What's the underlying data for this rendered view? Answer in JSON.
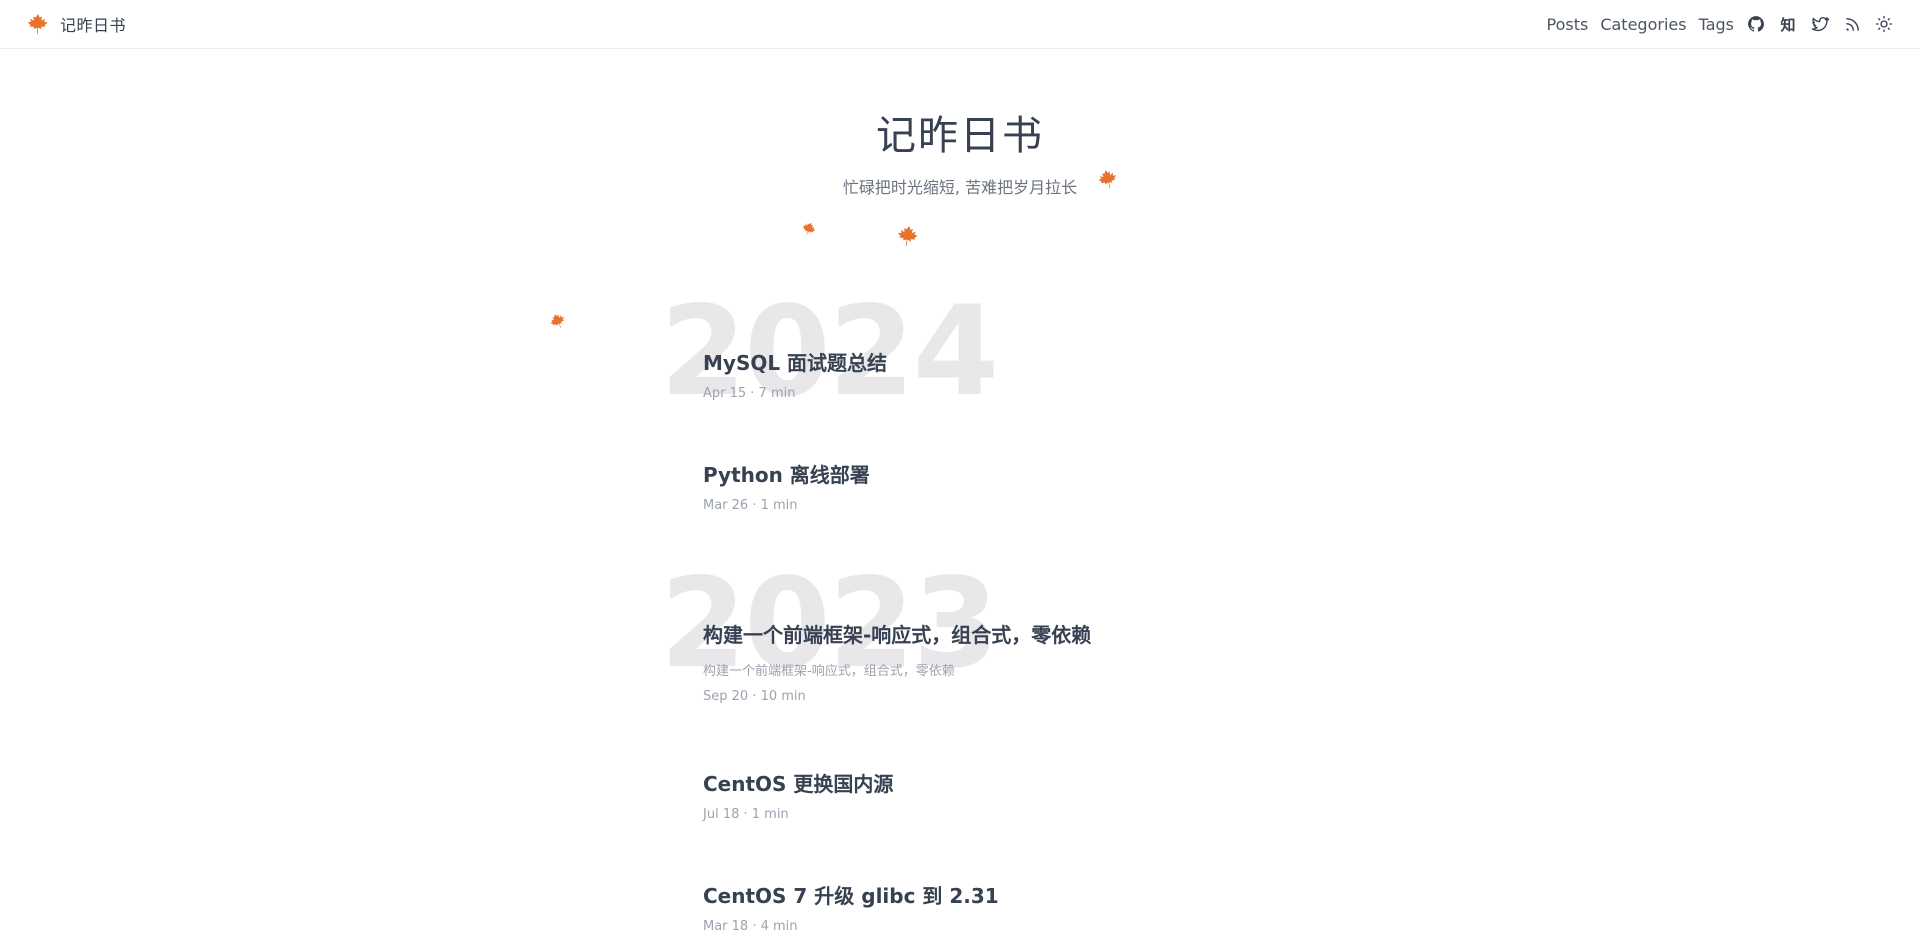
{
  "header": {
    "brand_title": "记昨日书",
    "nav": {
      "posts": "Posts",
      "categories": "Categories",
      "tags": "Tags",
      "zhihu_glyph": "知"
    },
    "icons": [
      "maple-leaf-icon",
      "github-icon",
      "zhihu-icon",
      "twitter-icon",
      "rss-icon",
      "sun-icon"
    ]
  },
  "hero": {
    "title": "记昨日书",
    "subtitle": "忙碌把时光缩短, 苦难把岁月拉长"
  },
  "colors": {
    "accent_leaf": "#e8712c",
    "year_watermark": "#e8e8ea",
    "text": "#374151",
    "muted": "#9ca3af"
  },
  "years": [
    {
      "year": "2024",
      "posts": [
        {
          "title": "MySQL 面试题总结",
          "meta": "Apr 15 · 7 min"
        },
        {
          "title": "Python 离线部署",
          "meta": "Mar 26 · 1 min"
        }
      ]
    },
    {
      "year": "2023",
      "posts": [
        {
          "title": "构建一个前端框架-响应式，组合式，零依赖",
          "desc": "构建一个前端框架-响应式，组合式，零依赖",
          "meta": "Sep 20 · 10 min"
        },
        {
          "title": "CentOS 更换国内源",
          "meta": "Jul 18 · 1 min"
        },
        {
          "title": "CentOS 7 升级 glibc 到 2.31",
          "meta": "Mar 18 · 4 min"
        }
      ]
    }
  ]
}
